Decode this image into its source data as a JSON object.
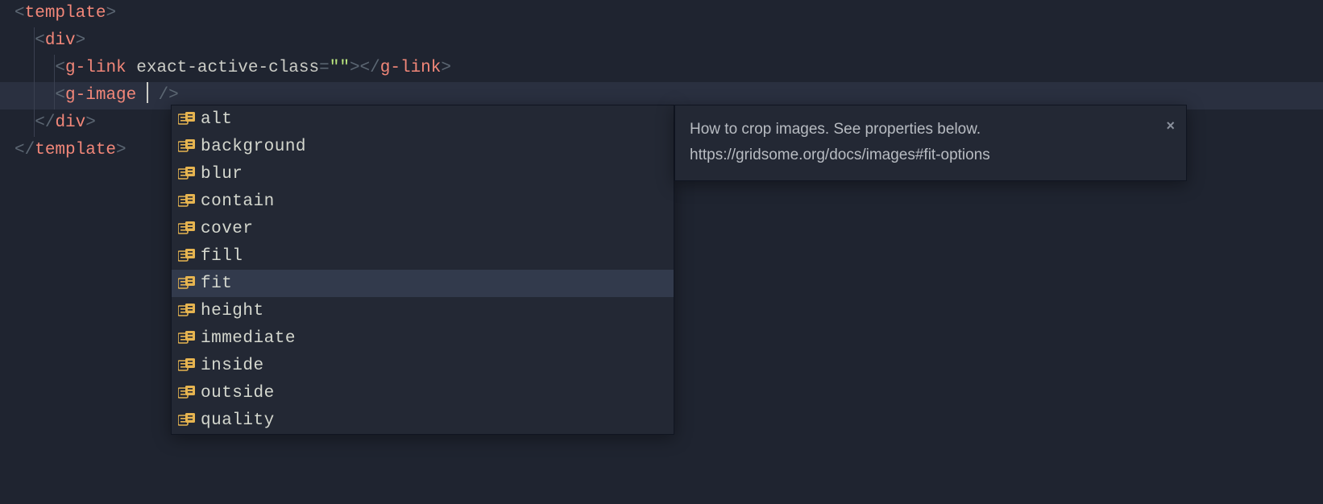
{
  "code": {
    "lines": [
      {
        "indent": 0,
        "tokens": [
          {
            "t": "<",
            "c": "bracket"
          },
          {
            "t": "template",
            "c": "tag"
          },
          {
            "t": ">",
            "c": "bracket"
          }
        ]
      },
      {
        "indent": 1,
        "tokens": [
          {
            "t": "<",
            "c": "bracket"
          },
          {
            "t": "div",
            "c": "tag"
          },
          {
            "t": ">",
            "c": "bracket"
          }
        ]
      },
      {
        "indent": 2,
        "tokens": [
          {
            "t": "<",
            "c": "bracket"
          },
          {
            "t": "g-link",
            "c": "tag"
          },
          {
            "t": " ",
            "c": ""
          },
          {
            "t": "exact-active-class",
            "c": "attr"
          },
          {
            "t": "=",
            "c": "punct"
          },
          {
            "t": "\"\"",
            "c": "string"
          },
          {
            "t": ">",
            "c": "bracket"
          },
          {
            "t": "</",
            "c": "bracket"
          },
          {
            "t": "g-link",
            "c": "tag"
          },
          {
            "t": ">",
            "c": "bracket"
          }
        ]
      },
      {
        "indent": 2,
        "current": true,
        "tokens": [
          {
            "t": "<",
            "c": "bracket"
          },
          {
            "t": "g-image",
            "c": "tag"
          },
          {
            "t": " ",
            "c": ""
          },
          {
            "cursor": true
          },
          {
            "t": " />",
            "c": "bracket"
          }
        ]
      },
      {
        "indent": 1,
        "tokens": [
          {
            "t": "</",
            "c": "bracket"
          },
          {
            "t": "div",
            "c": "tag"
          },
          {
            "t": ">",
            "c": "bracket"
          }
        ]
      },
      {
        "indent": 0,
        "tokens": [
          {
            "t": "</",
            "c": "bracket"
          },
          {
            "t": "template",
            "c": "tag"
          },
          {
            "t": ">",
            "c": "bracket"
          }
        ]
      }
    ]
  },
  "autocomplete": {
    "selectedIndex": 6,
    "items": [
      {
        "label": "alt"
      },
      {
        "label": "background"
      },
      {
        "label": "blur"
      },
      {
        "label": "contain"
      },
      {
        "label": "cover"
      },
      {
        "label": "fill"
      },
      {
        "label": "fit"
      },
      {
        "label": "height"
      },
      {
        "label": "immediate"
      },
      {
        "label": "inside"
      },
      {
        "label": "outside"
      },
      {
        "label": "quality"
      }
    ],
    "doc": {
      "description": "How to crop images. See properties below.",
      "url": "https://gridsome.org/docs/images#fit-options",
      "close": "×"
    }
  }
}
